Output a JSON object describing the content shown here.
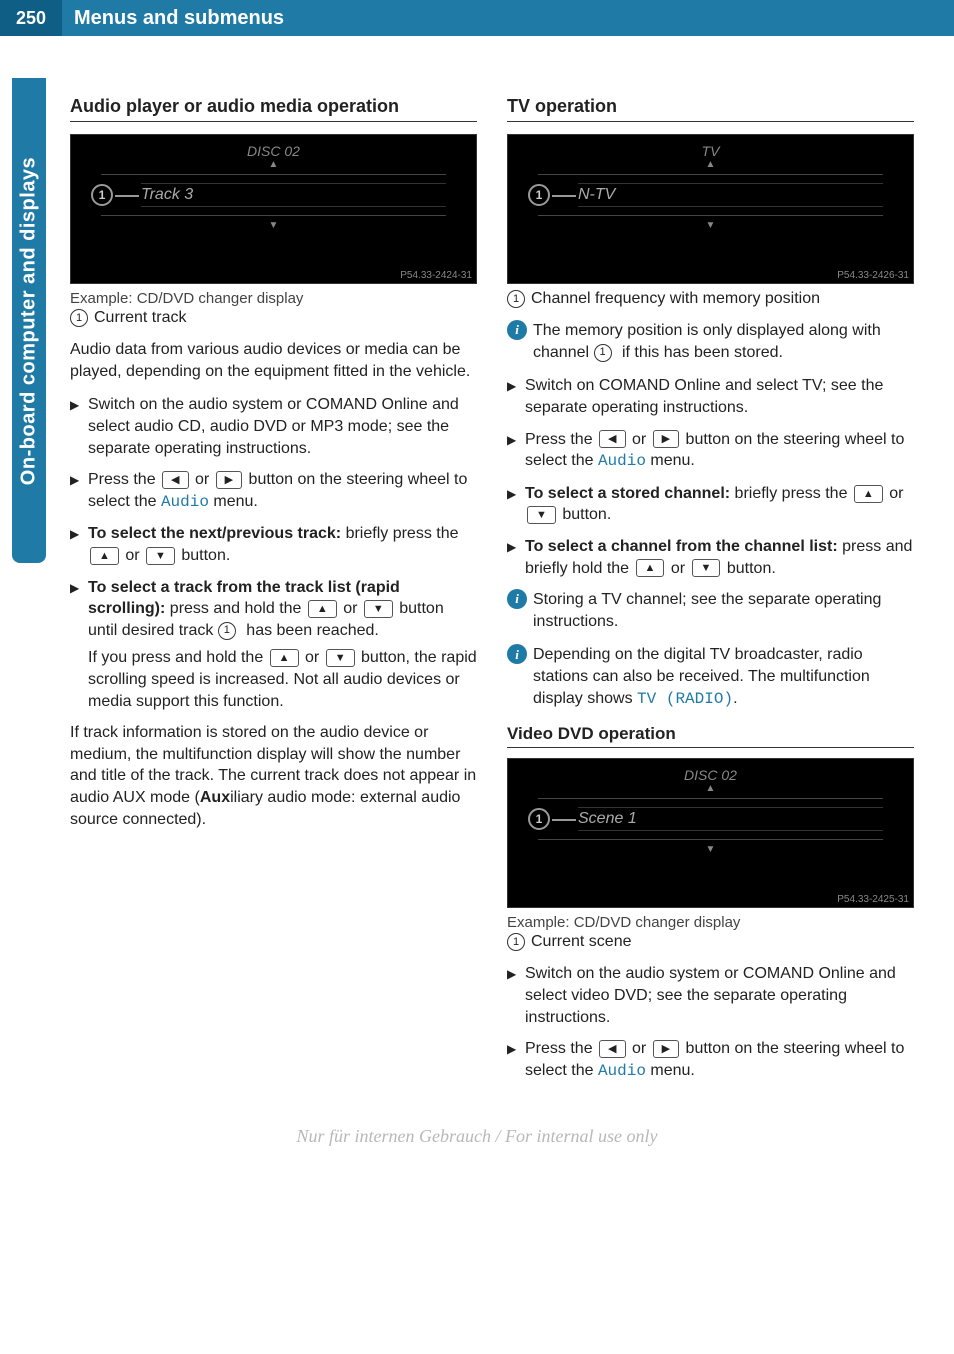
{
  "header": {
    "page_number": "250",
    "title": "Menus and submenus"
  },
  "side_tab": "On-board computer and displays",
  "left": {
    "section_title": "Audio player or audio media operation",
    "screen": {
      "top": "DISC 02",
      "mid": "Track 3",
      "code": "P54.33-2424-31"
    },
    "caption": "Example: CD/DVD changer display",
    "ref1_label": "Current track",
    "intro": "Audio data from various audio devices or media can be played, depending on the equipment fitted in the vehicle.",
    "step1": "Switch on the audio system or COMAND Online and select audio CD, audio DVD or MP3 mode; see the separate operating instructions.",
    "step2_a": "Press the ",
    "step2_b": " or ",
    "step2_c": " button on the steering wheel to select the ",
    "step2_menu": "Audio",
    "step2_d": " menu.",
    "step3_bold": "To select the next/previous track:",
    "step3_a": " briefly press the ",
    "step3_b": " or ",
    "step3_c": " button.",
    "step4_bold": "To select a track from the track list (rapid scrolling):",
    "step4_a": " press and hold the ",
    "step4_b": " or ",
    "step4_c": " button until desired track ",
    "step4_d": " has been reached.",
    "step4_note_a": "If you press and hold the ",
    "step4_note_b": " or ",
    "step4_note_c": " button, the rapid scrolling speed is increased. Not all audio devices or media support this function.",
    "outro_a": "If track information is stored on the audio device or medium, the multifunction display will show the number and title of the track. The current track does not appear in audio AUX mode (",
    "outro_bold": "Aux",
    "outro_b": "iliary audio mode: external audio source connected)."
  },
  "right": {
    "tv_title": "TV operation",
    "tv_screen": {
      "top": "TV",
      "mid": "N-TV",
      "code": "P54.33-2426-31"
    },
    "tv_ref1": "Channel frequency with memory position",
    "tv_info1_a": "The memory position is only displayed along with channel ",
    "tv_info1_b": " if this has been stored.",
    "tv_step1": "Switch on COMAND Online and select TV; see the separate operating instructions.",
    "tv_step2_a": "Press the ",
    "tv_step2_b": " or ",
    "tv_step2_c": " button on the steering wheel to select the ",
    "tv_step2_menu": "Audio",
    "tv_step2_d": " menu.",
    "tv_step3_bold": "To select a stored channel:",
    "tv_step3_a": " briefly press the ",
    "tv_step3_b": " or ",
    "tv_step3_c": " button.",
    "tv_step4_bold": "To select a channel from the channel list:",
    "tv_step4_a": " press and briefly hold the ",
    "tv_step4_b": " or ",
    "tv_step4_c": " button.",
    "tv_info2": "Storing a TV channel; see the separate operating instructions.",
    "tv_info3_a": "Depending on the digital TV broadcaster, radio stations can also be received. The multifunction display shows ",
    "tv_info3_code": "TV (RADIO)",
    "tv_info3_b": ".",
    "dvd_title": "Video DVD operation",
    "dvd_screen": {
      "top": "DISC 02",
      "mid": "Scene 1",
      "code": "P54.33-2425-31"
    },
    "dvd_caption": "Example: CD/DVD changer display",
    "dvd_ref1": "Current scene",
    "dvd_step1": "Switch on the audio system or COMAND Online and select video DVD; see the separate operating instructions.",
    "dvd_step2_a": "Press the ",
    "dvd_step2_b": " or ",
    "dvd_step2_c": " button on the steering wheel to select the ",
    "dvd_step2_menu": "Audio",
    "dvd_step2_d": " menu."
  },
  "watermark": "Nur für internen Gebrauch / For internal use only"
}
